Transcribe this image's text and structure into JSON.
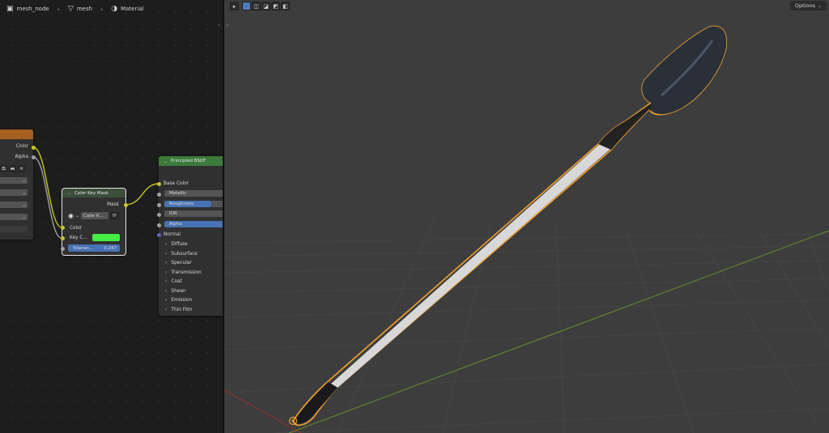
{
  "breadcrumb": {
    "items": [
      {
        "label": "mesh_node",
        "icon": "object-icon"
      },
      {
        "label": "mesh",
        "icon": "mesh-data-icon"
      },
      {
        "label": "Material",
        "icon": "material-icon"
      }
    ]
  },
  "image_node": {
    "outputs": [
      "Color",
      "Alpha"
    ]
  },
  "color_key_node": {
    "title": "Color Key Mask",
    "output": "Mask",
    "mode_value": "Color K...",
    "inputs": {
      "color": "Color",
      "key_color": "Key C..."
    },
    "tolerance": {
      "label": "Toleran...",
      "value": "0.247"
    },
    "key_color_hex": "#44ee44",
    "header_color": "#3a4f3a"
  },
  "bsdf_node": {
    "title": "Principled BSDF",
    "header_color": "#3b7a3b",
    "base_color": "Base Color",
    "fields": [
      "Metallic",
      "Roughness",
      "IOR",
      "Alpha"
    ],
    "normal": "Normal",
    "panels": [
      "Diffuse",
      "Subsurface",
      "Specular",
      "Transmission",
      "Coat",
      "Sheen",
      "Emission",
      "Thin Film"
    ]
  },
  "viewport": {
    "options_label": "Options",
    "outline_color": "#f0a030",
    "handle_color": "#d8d8d8"
  }
}
